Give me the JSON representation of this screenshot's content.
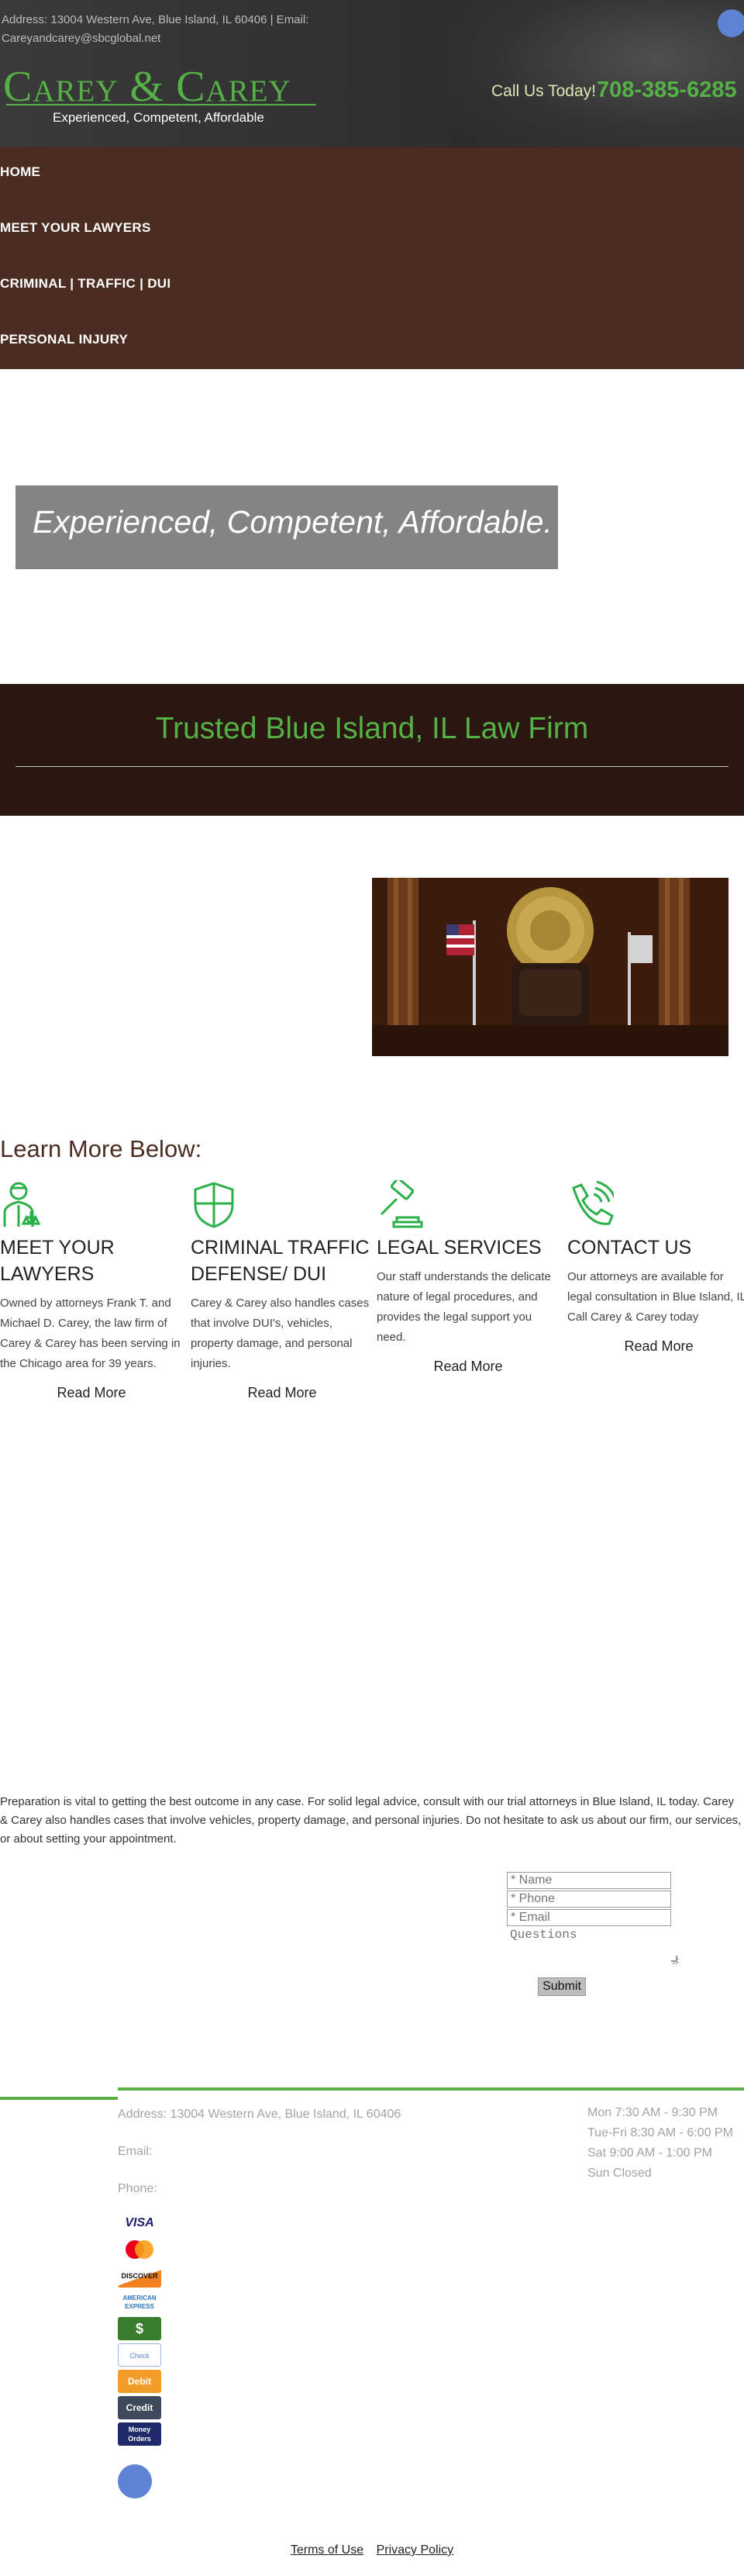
{
  "header": {
    "address_line": "Address: 13004 Western Ave, Blue Island, IL 60406 | Email: Careyandcarey@sbcglobal.net",
    "logo": "Carey & Carey",
    "tagline": "Experienced, Competent, Affordable",
    "call_label": "Call Us Today!",
    "phone": "708-385-6285"
  },
  "nav": {
    "items": [
      {
        "label": "HOME"
      },
      {
        "label": "MEET YOUR LAWYERS"
      },
      {
        "label": "CRIMINAL | TRAFFIC | DUI"
      },
      {
        "label": "PERSONAL INJURY"
      }
    ]
  },
  "hero": {
    "headline": "Experienced, Competent, Affordable."
  },
  "trusted": {
    "title": "Trusted Blue Island, IL Law Firm"
  },
  "learn_more": {
    "heading": "Learn More Below:",
    "columns": [
      {
        "icon": "lawyer-icon",
        "title": "MEET YOUR LAWYERS",
        "text": "Owned by attorneys Frank T. and Michael D. Carey, the law firm of Carey & Carey has been serving in the Chicago area for 39 years.",
        "link": "Read More"
      },
      {
        "icon": "shield-icon",
        "title": "CRIMINAL TRAFFIC DEFENSE/ DUI",
        "text": "Carey & Carey also handles cases that involve DUI's, vehicles, property damage, and personal injuries.",
        "link": "Read More"
      },
      {
        "icon": "gavel-icon",
        "title": "LEGAL SERVICES",
        "text": "Our staff understands the delicate nature of legal procedures, and provides the legal support you need.",
        "link": "Read More"
      },
      {
        "icon": "phone-icon",
        "title": "CONTACT US",
        "text": "Our attorneys are available for legal consultation in Blue Island, IL. Call Carey & Carey today",
        "link": "Read More"
      }
    ]
  },
  "preparation": {
    "text": "Preparation is vital to getting the best outcome in any case. For solid legal advice, consult with our trial attorneys in Blue Island, IL today. Carey & Carey also handles cases that involve vehicles, property damage, and personal injuries. Do not hesitate to ask us about our firm, our services, or about setting your appointment."
  },
  "form": {
    "name_placeholder": "* Name",
    "phone_placeholder": "* Phone",
    "email_placeholder": "* Email",
    "questions_placeholder": "Questions",
    "submit_label": "Submit"
  },
  "footer": {
    "address": "Address: 13004 Western Ave, Blue Island, IL 60406",
    "email_label": "Email:",
    "phone_label": "Phone:",
    "hours": [
      "Mon 7:30 AM - 9:30 PM",
      "Tue-Fri 8:30 AM - 6:00 PM",
      "Sat 9:00 AM - 1:00 PM",
      "Sun Closed"
    ],
    "payments": [
      {
        "label": "VISA",
        "icon": "visa-icon"
      },
      {
        "label": "",
        "icon": "mastercard-icon"
      },
      {
        "label": "DISCOVER",
        "icon": "discover-icon"
      },
      {
        "label": "AMERICAN EXPRESS",
        "icon": "amex-icon"
      },
      {
        "label": "$",
        "icon": "cash-icon"
      },
      {
        "label": "Check",
        "icon": "check-icon"
      },
      {
        "label": "Debit",
        "icon": "debit-icon"
      },
      {
        "label": "Credit",
        "icon": "credit-icon"
      },
      {
        "label": "Money Orders",
        "icon": "money-orders-icon"
      }
    ],
    "links": [
      "Terms of Use",
      "Privacy Policy"
    ]
  },
  "colors": {
    "brand_green": "#55b146",
    "nav_brown": "#4b2c21",
    "band_dark_brown": "#2a1711",
    "hero_gray": "#848484",
    "accent_blue": "#5f83d4"
  }
}
